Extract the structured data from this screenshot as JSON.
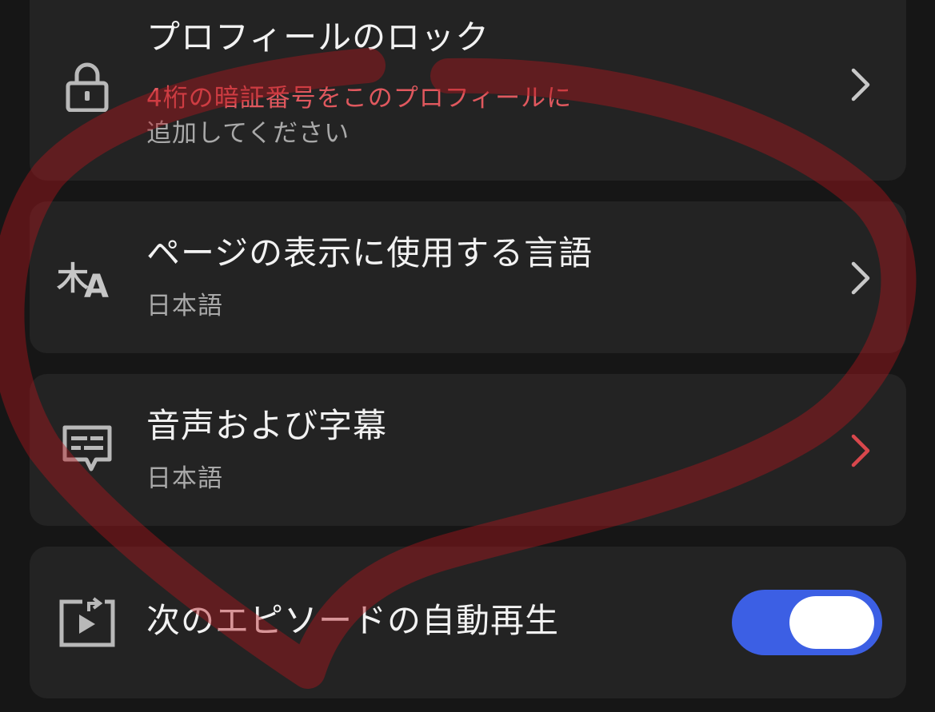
{
  "settings": {
    "profile_lock": {
      "title": "プロフィールのロック",
      "subtitle_line1": "4桁の暗証番号をこのプロフィールに",
      "subtitle_line2": "追加してください",
      "icon": "lock-icon"
    },
    "display_language": {
      "title": "ページの表示に使用する言語",
      "value": "日本語",
      "icon": "translate-icon"
    },
    "audio_subtitles": {
      "title": "音声および字幕",
      "value": "日本語",
      "icon": "subtitles-icon"
    },
    "autoplay_next": {
      "title": "次のエピソードの自動再生",
      "enabled": true,
      "icon": "autoplay-icon"
    }
  },
  "colors": {
    "background": "#161616",
    "card": "#232323",
    "text_primary": "#f2f2f2",
    "text_secondary": "#a9a9a9",
    "warning": "#e0585e",
    "toggle_on": "#3c5fe4",
    "annotation": "#b4161c"
  }
}
